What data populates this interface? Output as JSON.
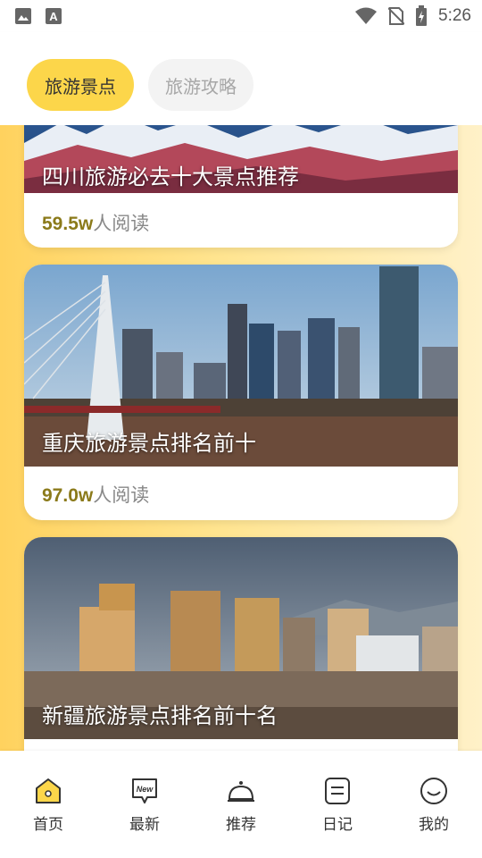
{
  "status_bar": {
    "time": "5:26"
  },
  "tabs": [
    {
      "label": "旅游景点",
      "active": true
    },
    {
      "label": "旅游攻略",
      "active": false
    }
  ],
  "cards": [
    {
      "title": "四川旅游必去十大景点推荐",
      "reads_num": "59.5w",
      "reads_suffix": "人阅读"
    },
    {
      "title": "重庆旅游景点排名前十",
      "reads_num": "97.0w",
      "reads_suffix": "人阅读"
    },
    {
      "title": "新疆旅游景点排名前十名",
      "reads_num": "",
      "reads_suffix": ""
    }
  ],
  "bottom_nav": [
    {
      "label": "首页",
      "icon": "home-icon",
      "active": true
    },
    {
      "label": "最新",
      "icon": "new-icon",
      "active": false
    },
    {
      "label": "推荐",
      "icon": "bell-icon",
      "active": false
    },
    {
      "label": "日记",
      "icon": "diary-icon",
      "active": false
    },
    {
      "label": "我的",
      "icon": "profile-icon",
      "active": false
    }
  ],
  "colors": {
    "accent": "#fcd64a",
    "read_count": "#8b7a1a",
    "background_gradient_start": "#ffd25e",
    "background_gradient_end": "#fff1c8"
  }
}
